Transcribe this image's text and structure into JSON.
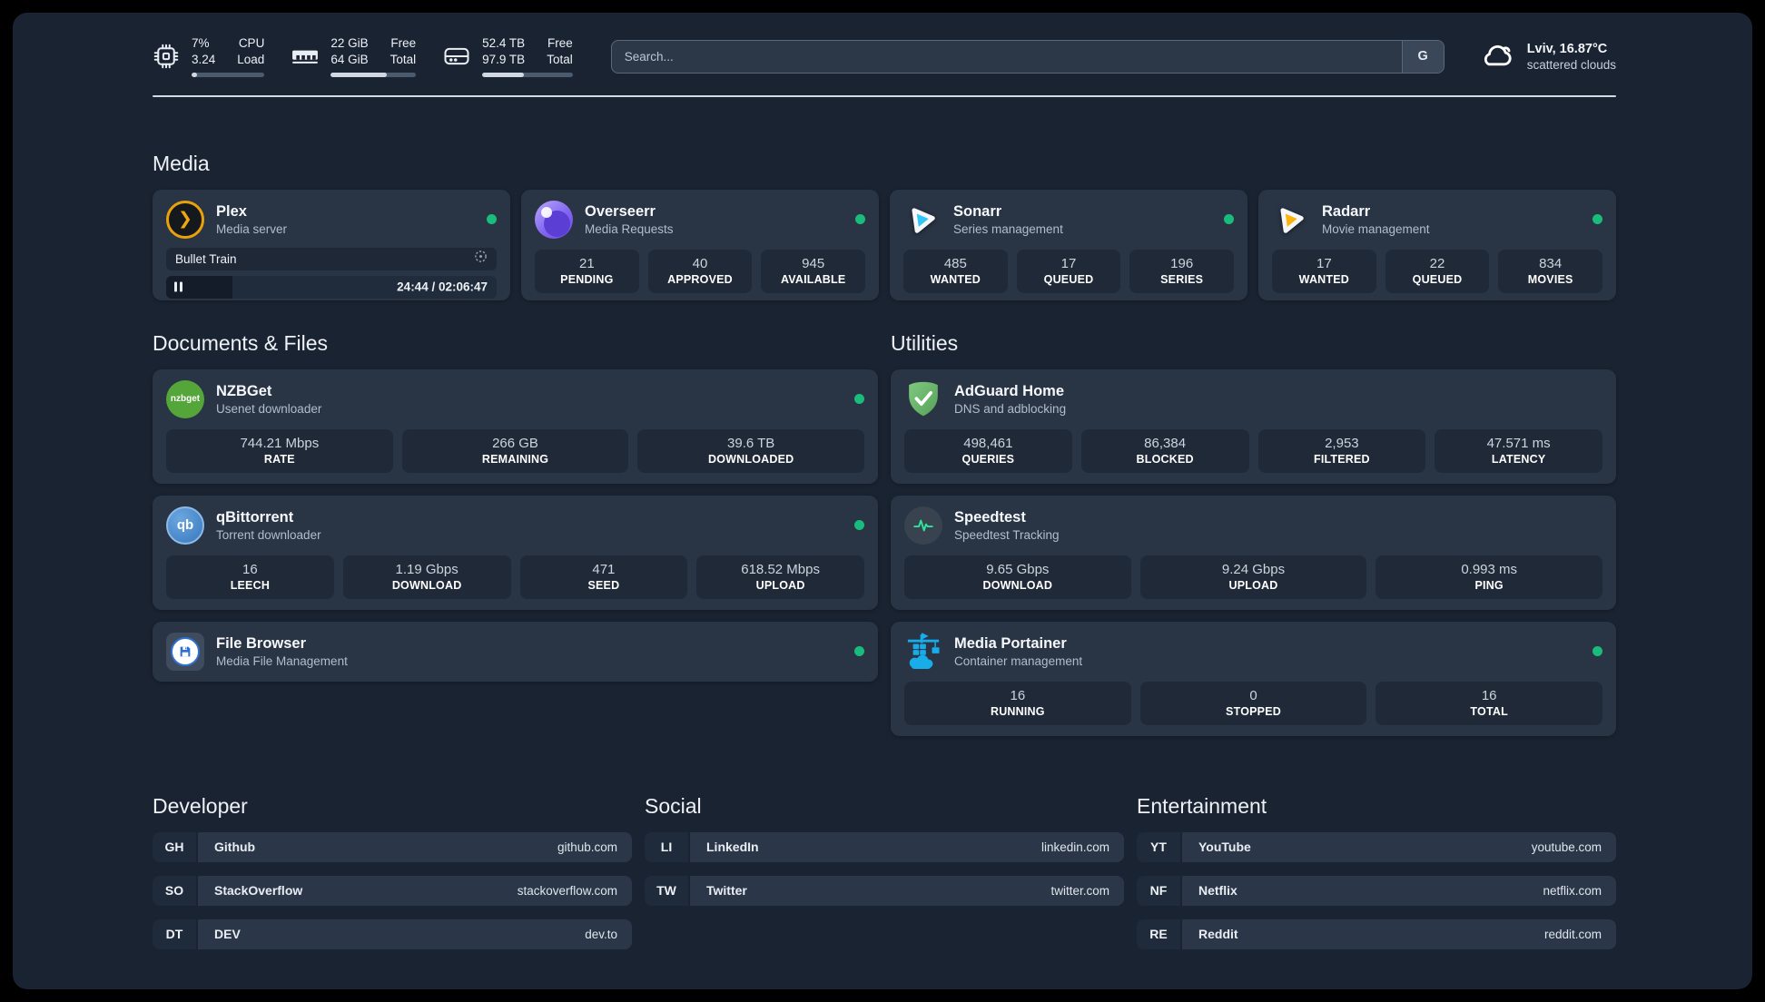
{
  "colors": {
    "status_online": "#1abc7b",
    "plex": "#e8a00b",
    "overseerr": "#8266f0",
    "sonarr": "#33c5f3",
    "radarr": "#fdb30e",
    "nzbget": "#55a63a",
    "qbittorrent": "#4787c7",
    "filebrowser": "#2f6fd0",
    "adguard": "#68b474",
    "speedtest": "#2fe39b",
    "portainer": "#18ace8"
  },
  "icons": {
    "header": [
      "cpu-icon",
      "ram-icon",
      "disk-icon"
    ],
    "weather": "cloud-icon",
    "plex_glyph": "❯",
    "nzbget_text": "nzbget",
    "qb_text": "qb"
  },
  "header": {
    "metrics": [
      {
        "icon": "cpu-icon",
        "values": [
          "7%",
          "3.24"
        ],
        "labels": [
          "CPU",
          "Load"
        ],
        "usage_percent": 7
      },
      {
        "icon": "ram-icon",
        "values": [
          "22 GiB",
          "64 GiB"
        ],
        "labels": [
          "Free",
          "Total"
        ],
        "usage_percent": 66
      },
      {
        "icon": "disk-icon",
        "values": [
          "52.4 TB",
          "97.9 TB"
        ],
        "labels": [
          "Free",
          "Total"
        ],
        "usage_percent": 46
      }
    ],
    "search": {
      "placeholder": "Search...",
      "engine_label": "G"
    },
    "weather": {
      "location": "Lviv, 16.87°C",
      "condition": "scattered clouds"
    }
  },
  "media": {
    "title": "Media",
    "plex": {
      "name": "Plex",
      "description": "Media server",
      "online": true,
      "now_playing": "Bullet Train",
      "time": "24:44 / 02:06:47",
      "progress_percent": 20
    },
    "overseerr": {
      "name": "Overseerr",
      "description": "Media Requests",
      "online": true,
      "stats": [
        {
          "value": "21",
          "label": "PENDING"
        },
        {
          "value": "40",
          "label": "APPROVED"
        },
        {
          "value": "945",
          "label": "AVAILABLE"
        }
      ]
    },
    "sonarr": {
      "name": "Sonarr",
      "description": "Series management",
      "online": true,
      "stats": [
        {
          "value": "485",
          "label": "WANTED"
        },
        {
          "value": "17",
          "label": "QUEUED"
        },
        {
          "value": "196",
          "label": "SERIES"
        }
      ]
    },
    "radarr": {
      "name": "Radarr",
      "description": "Movie management",
      "online": true,
      "stats": [
        {
          "value": "17",
          "label": "WANTED"
        },
        {
          "value": "22",
          "label": "QUEUED"
        },
        {
          "value": "834",
          "label": "MOVIES"
        }
      ]
    }
  },
  "documents": {
    "title": "Documents & Files",
    "nzbget": {
      "name": "NZBGet",
      "description": "Usenet downloader",
      "online": true,
      "stats": [
        {
          "value": "744.21 Mbps",
          "label": "RATE"
        },
        {
          "value": "266 GB",
          "label": "REMAINING"
        },
        {
          "value": "39.6 TB",
          "label": "DOWNLOADED"
        }
      ]
    },
    "qbittorrent": {
      "name": "qBittorrent",
      "description": "Torrent downloader",
      "online": true,
      "stats": [
        {
          "value": "16",
          "label": "LEECH"
        },
        {
          "value": "1.19 Gbps",
          "label": "DOWNLOAD"
        },
        {
          "value": "471",
          "label": "SEED"
        },
        {
          "value": "618.52 Mbps",
          "label": "UPLOAD"
        }
      ]
    },
    "filebrowser": {
      "name": "File Browser",
      "description": "Media File Management",
      "online": true
    }
  },
  "utilities": {
    "title": "Utilities",
    "adguard": {
      "name": "AdGuard Home",
      "description": "DNS and adblocking",
      "stats": [
        {
          "value": "498,461",
          "label": "QUERIES"
        },
        {
          "value": "86,384",
          "label": "BLOCKED"
        },
        {
          "value": "2,953",
          "label": "FILTERED"
        },
        {
          "value": "47.571 ms",
          "label": "LATENCY"
        }
      ]
    },
    "speedtest": {
      "name": "Speedtest",
      "description": "Speedtest Tracking",
      "stats": [
        {
          "value": "9.65 Gbps",
          "label": "DOWNLOAD"
        },
        {
          "value": "9.24 Gbps",
          "label": "UPLOAD"
        },
        {
          "value": "0.993 ms",
          "label": "PING"
        }
      ]
    },
    "portainer": {
      "name": "Media Portainer",
      "description": "Container management",
      "online": true,
      "stats": [
        {
          "value": "16",
          "label": "RUNNING"
        },
        {
          "value": "0",
          "label": "STOPPED"
        },
        {
          "value": "16",
          "label": "TOTAL"
        }
      ]
    }
  },
  "bookmarks": {
    "developer": {
      "title": "Developer",
      "links": [
        {
          "abbr": "GH",
          "name": "Github",
          "url": "github.com"
        },
        {
          "abbr": "SO",
          "name": "StackOverflow",
          "url": "stackoverflow.com"
        },
        {
          "abbr": "DT",
          "name": "DEV",
          "url": "dev.to"
        }
      ]
    },
    "social": {
      "title": "Social",
      "links": [
        {
          "abbr": "LI",
          "name": "LinkedIn",
          "url": "linkedin.com"
        },
        {
          "abbr": "TW",
          "name": "Twitter",
          "url": "twitter.com"
        }
      ]
    },
    "entertainment": {
      "title": "Entertainment",
      "links": [
        {
          "abbr": "YT",
          "name": "YouTube",
          "url": "youtube.com"
        },
        {
          "abbr": "NF",
          "name": "Netflix",
          "url": "netflix.com"
        },
        {
          "abbr": "RE",
          "name": "Reddit",
          "url": "reddit.com"
        }
      ]
    }
  }
}
